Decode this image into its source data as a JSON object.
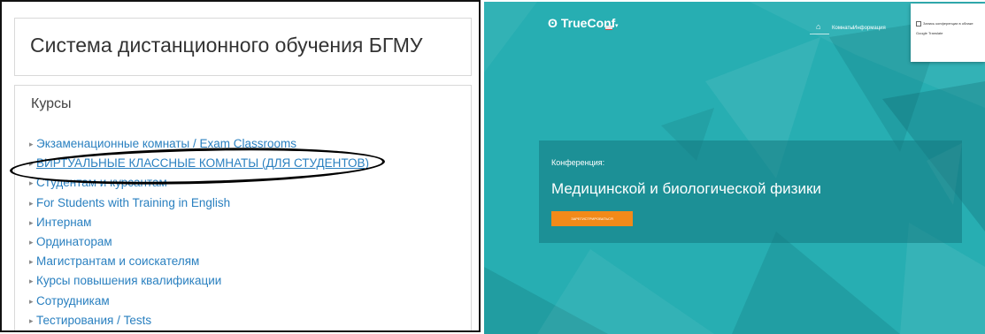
{
  "left_panel": {
    "site_title": "Система дистанционного обучения БГМУ",
    "courses_heading": "Курсы",
    "courses": [
      {
        "label": "Экзаменационные комнаты / Exam Classrooms",
        "highlighted": false
      },
      {
        "label": "ВИРТУАЛЬНЫЕ КЛАССНЫЕ КОМНАТЫ (ДЛЯ СТУДЕНТОВ)",
        "highlighted": true
      },
      {
        "label": "Студентам и курсантам",
        "highlighted": false
      },
      {
        "label": "For Students with Training in English",
        "highlighted": false
      },
      {
        "label": "Интернам",
        "highlighted": false
      },
      {
        "label": "Ординаторам",
        "highlighted": false
      },
      {
        "label": "Магистрантам и соискателям",
        "highlighted": false
      },
      {
        "label": "Курсы повышения квалификации",
        "highlighted": false
      },
      {
        "label": "Сотрудникам",
        "highlighted": false
      },
      {
        "label": "Тестирования / Tests",
        "highlighted": false
      }
    ],
    "bullet": "▸",
    "link_color": "#2a80c0",
    "annotation_color": "#000000"
  },
  "right_panel": {
    "logo_text": "TrueConf",
    "logo_glyph": "ʘ",
    "nav": {
      "home_icon": "⌂",
      "rooms": "Комнаты",
      "info": "Информация"
    },
    "dropdown": {
      "item_1": "Запись конференции в облаке",
      "item_2": "Google Translate"
    },
    "conference": {
      "label": "Конференция:",
      "title": "Медицинской и биологической физики",
      "register_button": "ЗАРЕГИСТРИРОВАТЬСЯ"
    },
    "background_color": "#27aeb2",
    "button_color": "#f28a19"
  }
}
